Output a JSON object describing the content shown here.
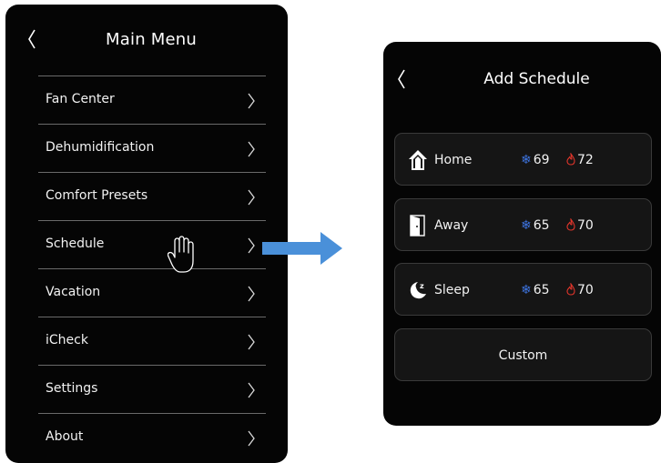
{
  "main_menu": {
    "title": "Main Menu",
    "back_icon": "chevron-left-icon",
    "items": [
      {
        "label": "Fan Center"
      },
      {
        "label": "Dehumidification"
      },
      {
        "label": "Comfort Presets"
      },
      {
        "label": "Schedule"
      },
      {
        "label": "Vacation"
      },
      {
        "label": "iCheck"
      },
      {
        "label": "Settings"
      },
      {
        "label": "About"
      }
    ],
    "selected_item": "Schedule",
    "pointer_icon": "hand-pointer-icon"
  },
  "transition_arrow": {
    "icon": "arrow-right-icon",
    "color": "#4a90d9"
  },
  "add_schedule": {
    "title": "Add Schedule",
    "back_icon": "chevron-left-icon",
    "presets": [
      {
        "label": "Home",
        "icon": "house-icon",
        "cool": "69",
        "heat": "72"
      },
      {
        "label": "Away",
        "icon": "door-icon",
        "cool": "65",
        "heat": "70"
      },
      {
        "label": "Sleep",
        "icon": "moon-sleep-icon",
        "cool": "65",
        "heat": "70"
      }
    ],
    "custom_label": "Custom",
    "cool_icon": "snowflake-icon",
    "heat_icon": "flame-icon",
    "cool_color": "#3d74e0",
    "heat_color": "#e0352b"
  }
}
